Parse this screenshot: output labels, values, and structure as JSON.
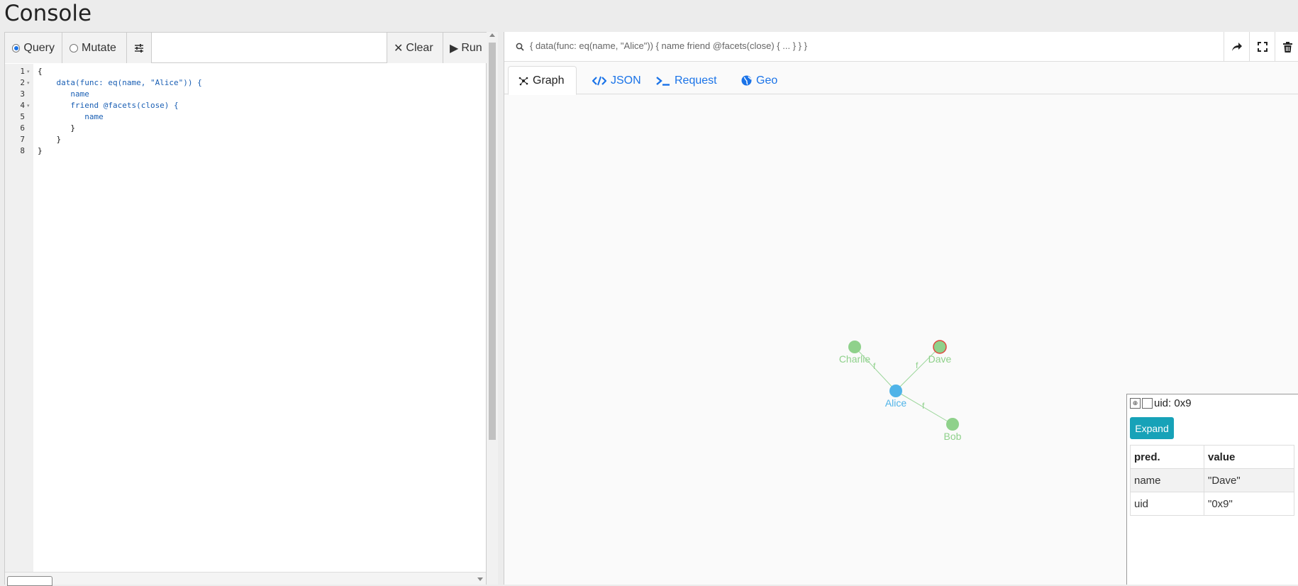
{
  "page": {
    "title": "Console"
  },
  "editor": {
    "modes": [
      {
        "label": "Query",
        "selected": true
      },
      {
        "label": "Mutate",
        "selected": false
      }
    ],
    "settings_icon": "sliders-icon",
    "clear_label": "Clear",
    "run_label": "Run",
    "line_numbers": [
      "1",
      "2",
      "3",
      "4",
      "5",
      "6",
      "7",
      "8"
    ],
    "code_lines": [
      "{",
      "    data(func: eq(name, \"Alice\")) {",
      "       name",
      "       friend @facets(close) {",
      "          name",
      "       }",
      "    }",
      "}"
    ]
  },
  "result": {
    "query_summary": "{ data(func: eq(name, \"Alice\")) { name friend @facets(close) { ... } } }",
    "tabs": [
      {
        "label": "Graph",
        "icon": "graph-icon",
        "active": true
      },
      {
        "label": "JSON",
        "icon": "code-icon",
        "active": false
      },
      {
        "label": "Request",
        "icon": "terminal-icon",
        "active": false
      },
      {
        "label": "Geo",
        "icon": "globe-icon",
        "active": false
      }
    ],
    "graph": {
      "nodes": [
        {
          "label": "Alice",
          "color": "#4fb3e8"
        },
        {
          "label": "Charlie",
          "color": "#8fd18b"
        },
        {
          "label": "Dave",
          "color": "#8fd18b",
          "selected": true
        },
        {
          "label": "Bob",
          "color": "#8fd18b"
        }
      ],
      "edges": [
        {
          "from": "Alice",
          "to": "Charlie",
          "label": "f"
        },
        {
          "from": "Alice",
          "to": "Dave",
          "label": "f"
        },
        {
          "from": "Alice",
          "to": "Bob",
          "label": "f"
        }
      ]
    },
    "node_panel": {
      "title": "uid: 0x9",
      "expand_label": "Expand",
      "headers": [
        "pred.",
        "value"
      ],
      "rows": [
        {
          "pred": "name",
          "value": "\"Dave\""
        },
        {
          "pred": "uid",
          "value": "\"0x9\""
        }
      ]
    }
  }
}
